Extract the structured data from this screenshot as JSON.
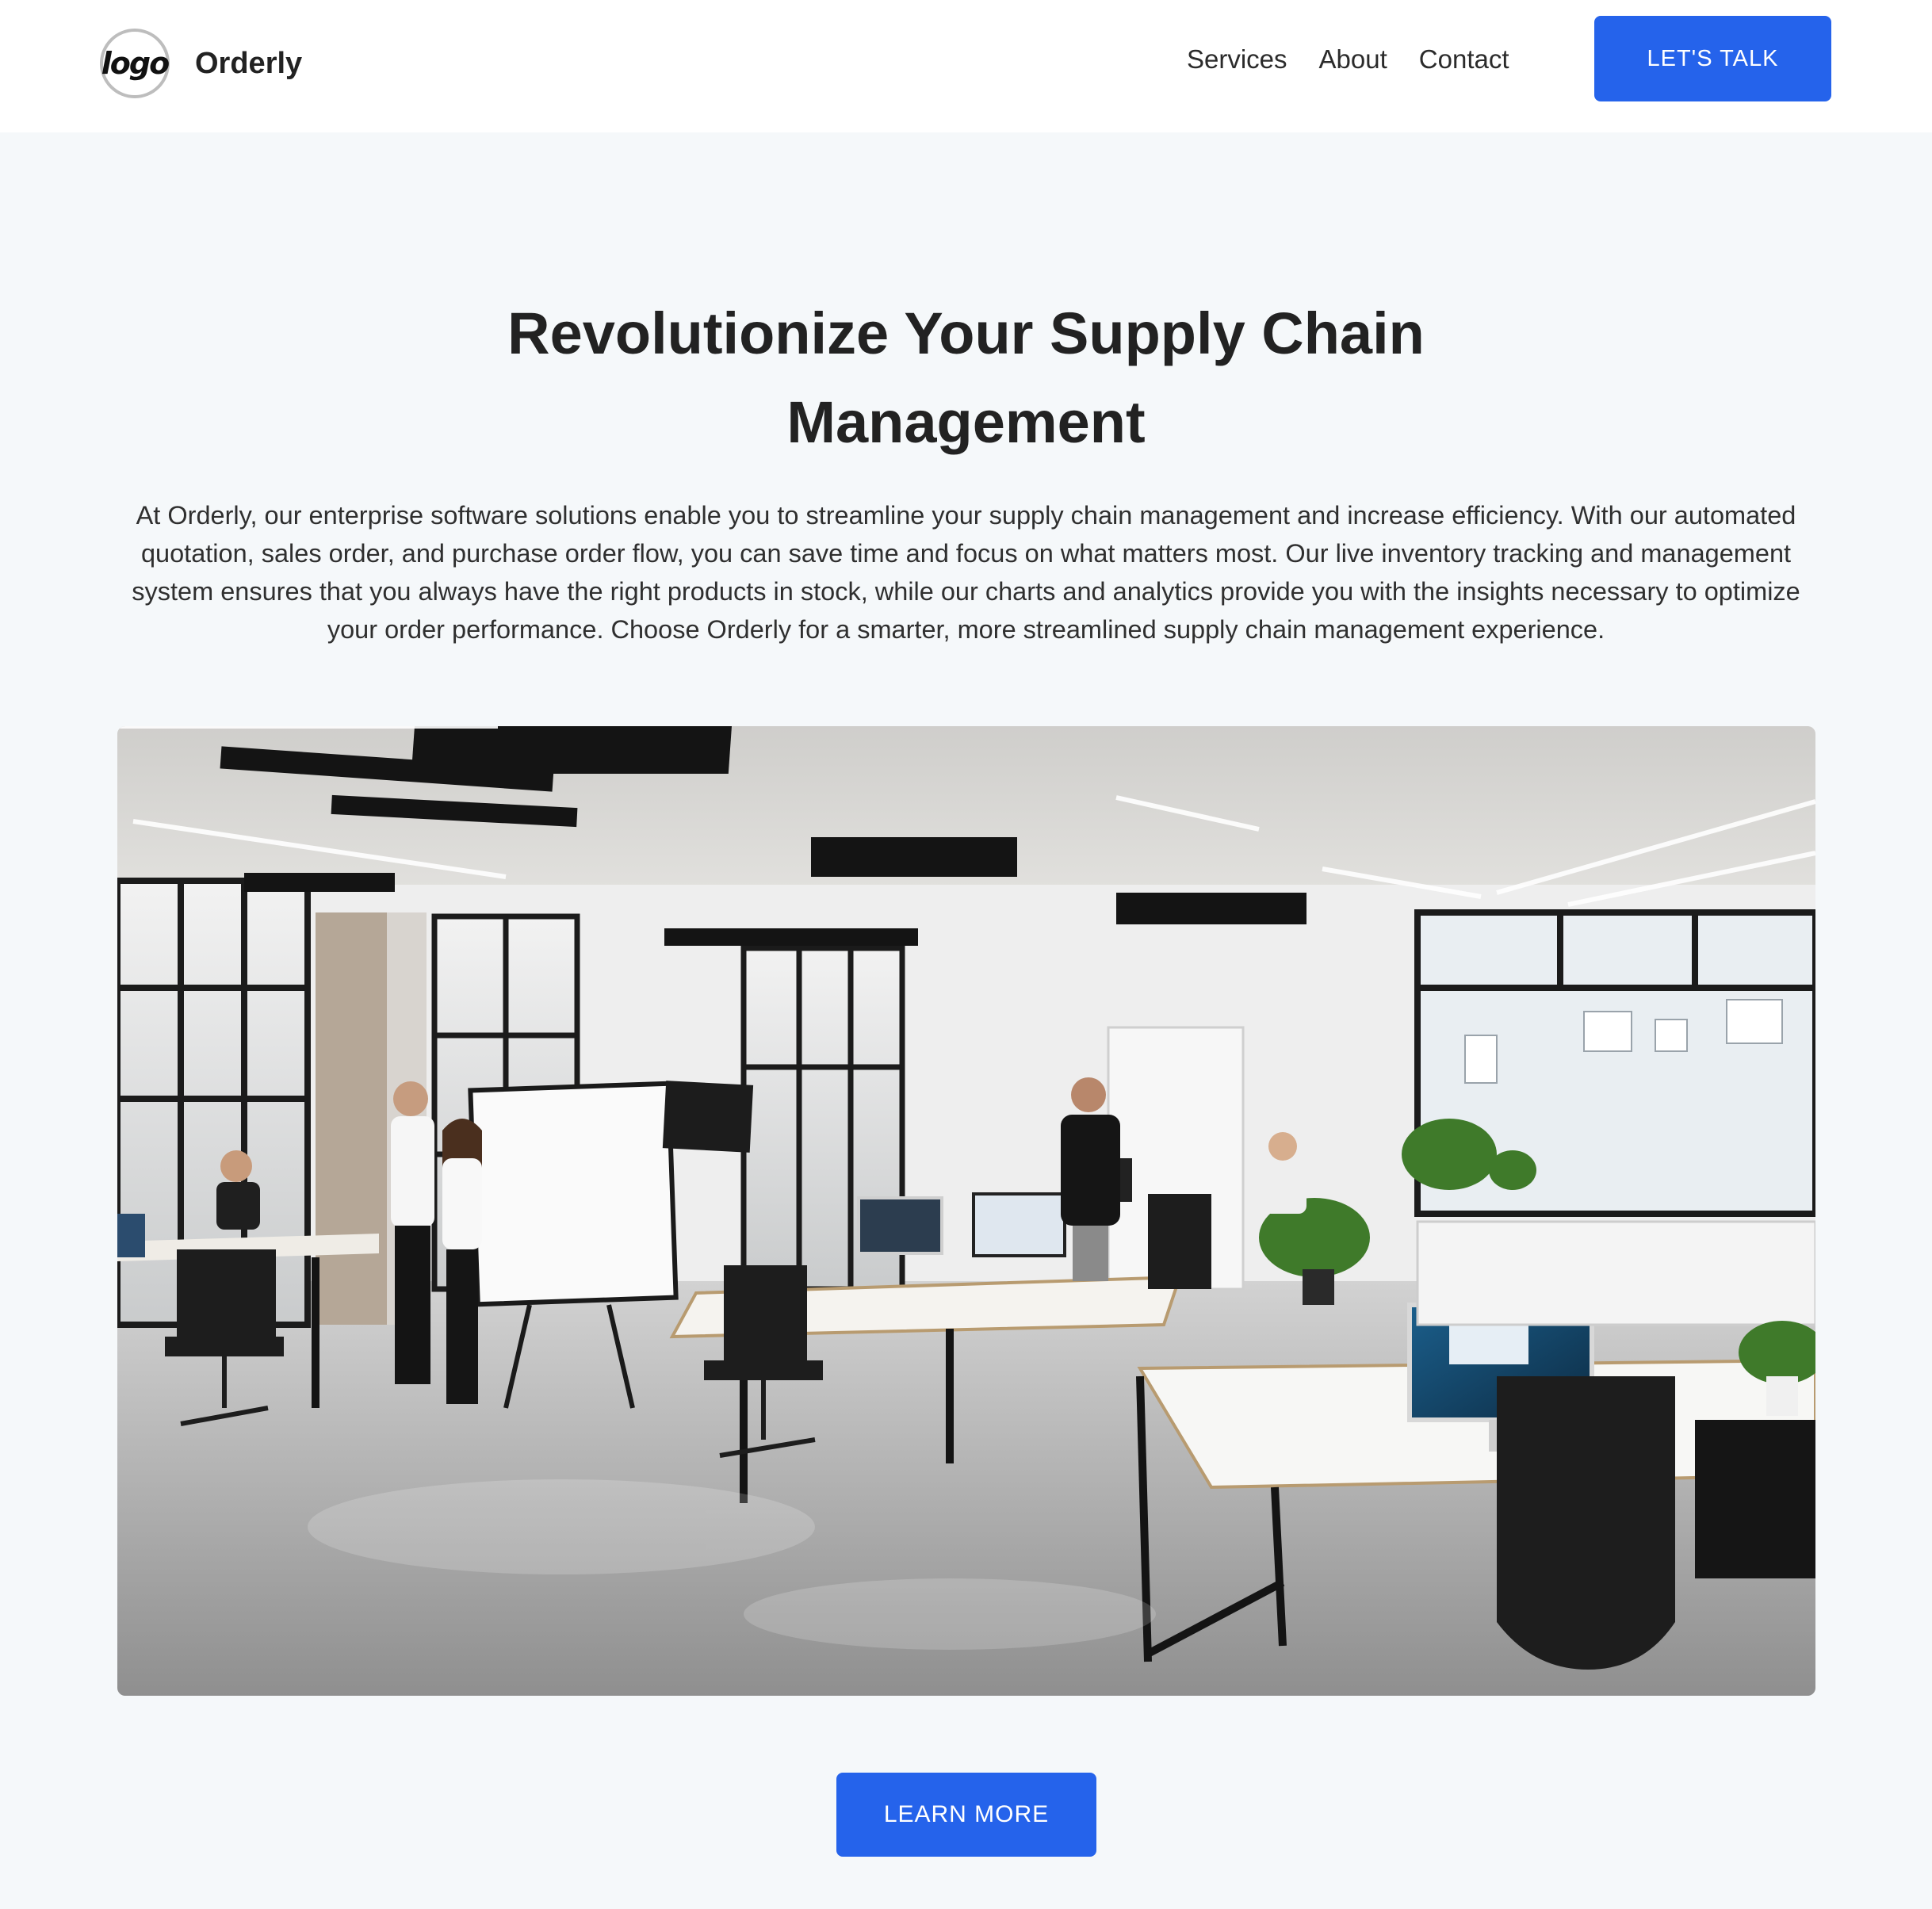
{
  "header": {
    "logo_text": "logo",
    "brand_name": "Orderly",
    "nav": [
      "Services",
      "About",
      "Contact"
    ],
    "cta_label": "LET'S TALK"
  },
  "hero": {
    "title_line1": "Revolutionize Your Supply Chain",
    "title_line2": "Management",
    "description": "At Orderly, our enterprise software solutions enable you to streamline your supply chain management and increase efficiency. With our automated quotation, sales order, and purchase order flow, you can save time and focus on what matters most. Our live inventory tracking and management system ensures that you always have the right products in stock, while our charts and analytics provide you with the insights necessary to optimize your order performance. Choose Orderly for a smarter, more streamlined supply chain management experience.",
    "image_subject": "modern open-plan office with desks, monitors, whiteboards and people working",
    "cta_label": "LEARN MORE"
  },
  "colors": {
    "accent": "#2563eb",
    "page_bg": "#f5f8fa",
    "header_bg": "#ffffff",
    "text": "#222222"
  }
}
